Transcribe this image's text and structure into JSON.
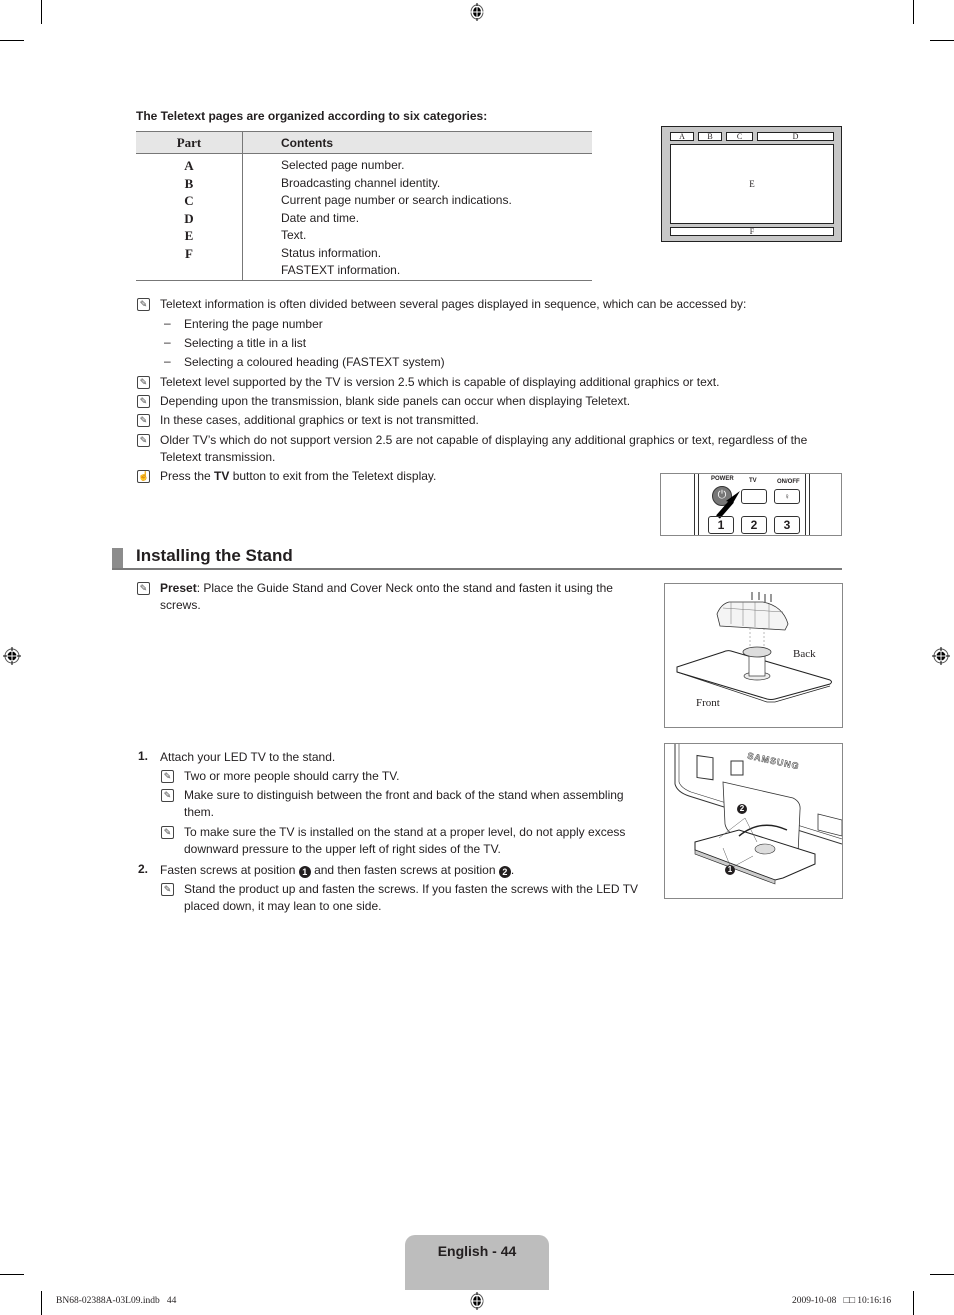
{
  "teletext": {
    "intro": "The Teletext pages are organized according to six categories:",
    "table": {
      "headers": [
        "Part",
        "Contents"
      ],
      "rows": [
        {
          "part": "A",
          "contents": "Selected page number."
        },
        {
          "part": "B",
          "contents": "Broadcasting channel identity."
        },
        {
          "part": "C",
          "contents": "Current page number or search indications."
        },
        {
          "part": "D",
          "contents": "Date and time."
        },
        {
          "part": "E",
          "contents": "Text."
        },
        {
          "part": "F",
          "contents": "Status information."
        },
        {
          "part": "",
          "contents": "FASTEXT information."
        }
      ]
    },
    "diagram_labels": {
      "a": "A",
      "b": "B",
      "c": "C",
      "d": "D",
      "e": "E",
      "f": "F"
    },
    "notes": [
      {
        "icon": "note-icon",
        "text": "Teletext information is often divided between several pages displayed in sequence, which can be accessed by:"
      },
      {
        "icon": "note-icon",
        "text": "Teletext level supported by the TV is version 2.5 which is capable of displaying additional graphics or text."
      },
      {
        "icon": "note-icon",
        "text": "Depending upon the transmission, blank side panels can occur when displaying Teletext."
      },
      {
        "icon": "note-icon",
        "text": "In these cases, additional graphics or text is not transmitted."
      },
      {
        "icon": "note-icon",
        "text": "Older TV’s which do not support version 2.5 are not capable of displaying any additional graphics or text, regardless of the Teletext transmission."
      }
    ],
    "access_methods": [
      "Entering the page number",
      "Selecting a title in a list",
      "Selecting a coloured heading (FASTEXT system)"
    ],
    "press_note": {
      "icon": "remote-button-icon",
      "prefix": "Press the ",
      "bold": "TV",
      "suffix": " button to exit from the Teletext display."
    },
    "remote": {
      "power": "POWER",
      "tv": "TV",
      "onoff": "ON/OFF",
      "keys": [
        "1",
        "2",
        "3"
      ]
    }
  },
  "stand": {
    "title": "Installing the Stand",
    "preset": {
      "bold": "Preset",
      "text": ": Place the Guide Stand and Cover Neck onto the stand and fasten it using the screws."
    },
    "figure1": {
      "back": "Back",
      "front": "Front"
    },
    "figure2": {
      "brand": "SAMSUNG",
      "marker1": "1",
      "marker2": "2"
    },
    "steps": [
      {
        "num": "1.",
        "text": "Attach your LED TV to the stand.",
        "notes": [
          "Two or more people should carry the TV.",
          "Make sure to distinguish between the front and back of the stand when assembling them.",
          "To make sure the TV is installed on the stand at a proper level, do not apply excess downward pressure to the upper left of right sides of the TV."
        ]
      },
      {
        "num": "2.",
        "text_a": "Fasten screws at position ",
        "pos1": "1",
        "text_b": " and then fasten screws at position ",
        "pos2": "2",
        "text_c": ".",
        "notes": [
          "Stand the product up and fasten the screws. If you fasten the screws with the LED TV placed down, it may lean to one side."
        ]
      }
    ]
  },
  "footer": {
    "page_label": "English - 44",
    "file": "BN68-02388A-03L09.indb   44",
    "timestamp": "2009-10-08   □□ 10:16:16"
  }
}
